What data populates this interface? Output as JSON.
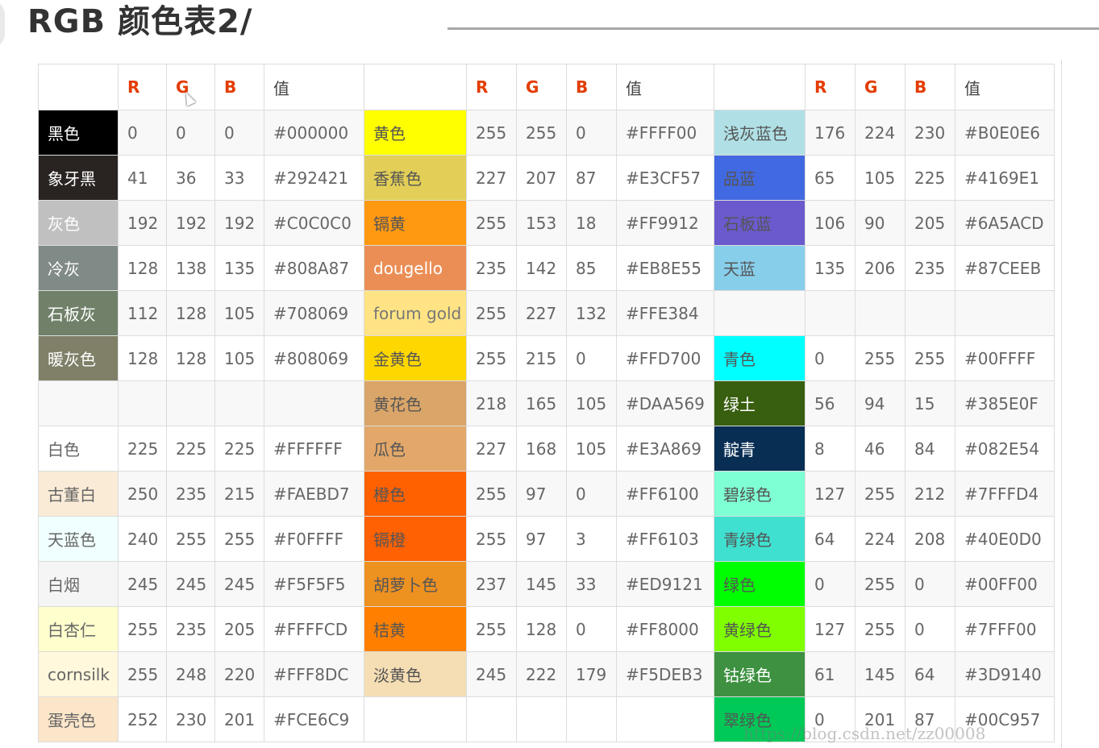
{
  "title": "RGB 颜色表2/",
  "header": [
    "",
    "R",
    "G",
    "B",
    "值",
    "",
    "R",
    "G",
    "B",
    "值",
    "",
    "R",
    "G",
    "B",
    "值"
  ],
  "rows": [
    [
      {
        "name": "黑色",
        "bg": "#000000",
        "fg": "#ffffff",
        "r": "0",
        "g": "0",
        "b": "0",
        "hex": "#000000"
      },
      {
        "name": "黄色",
        "bg": "#FFFF00",
        "fg": "#555555",
        "r": "255",
        "g": "255",
        "b": "0",
        "hex": "#FFFF00"
      },
      {
        "name": "浅灰蓝色",
        "bg": "#B0E0E6",
        "fg": "#555555",
        "r": "176",
        "g": "224",
        "b": "230",
        "hex": "#B0E0E6"
      }
    ],
    [
      {
        "name": "象牙黑",
        "bg": "#292421",
        "fg": "#ffffff",
        "r": "41",
        "g": "36",
        "b": "33",
        "hex": "#292421"
      },
      {
        "name": "香蕉色",
        "bg": "#E3CF57",
        "fg": "#555555",
        "r": "227",
        "g": "207",
        "b": "87",
        "hex": "#E3CF57"
      },
      {
        "name": "品蓝",
        "bg": "#4169E1",
        "fg": "#555555",
        "r": "65",
        "g": "105",
        "b": "225",
        "hex": "#4169E1"
      }
    ],
    [
      {
        "name": "灰色",
        "bg": "#C0C0C0",
        "fg": "#ffffff",
        "r": "192",
        "g": "192",
        "b": "192",
        "hex": "#C0C0C0"
      },
      {
        "name": "镉黄",
        "bg": "#FF9912",
        "fg": "#555555",
        "r": "255",
        "g": "153",
        "b": "18",
        "hex": "#FF9912"
      },
      {
        "name": "石板蓝",
        "bg": "#6A5ACD",
        "fg": "#555555",
        "r": "106",
        "g": "90",
        "b": "205",
        "hex": "#6A5ACD"
      }
    ],
    [
      {
        "name": "冷灰",
        "bg": "#808A87",
        "fg": "#ffffff",
        "r": "128",
        "g": "138",
        "b": "135",
        "hex": "#808A87"
      },
      {
        "name": "dougello",
        "bg": "#EB8E55",
        "fg": "#ffffff",
        "r": "235",
        "g": "142",
        "b": "85",
        "hex": "#EB8E55"
      },
      {
        "name": "天蓝",
        "bg": "#87CEEB",
        "fg": "#555555",
        "r": "135",
        "g": "206",
        "b": "235",
        "hex": "#87CEEB"
      }
    ],
    [
      {
        "name": "石板灰",
        "bg": "#708069",
        "fg": "#ffffff",
        "r": "112",
        "g": "128",
        "b": "105",
        "hex": "#708069"
      },
      {
        "name": "forum gold",
        "bg": "#FFE384",
        "fg": "#777777",
        "r": "255",
        "g": "227",
        "b": "132",
        "hex": "#FFE384"
      },
      {
        "name": "",
        "bg": "",
        "fg": "",
        "r": "",
        "g": "",
        "b": "",
        "hex": ""
      }
    ],
    [
      {
        "name": "暖灰色",
        "bg": "#808069",
        "fg": "#ffffff",
        "r": "128",
        "g": "128",
        "b": "105",
        "hex": "#808069"
      },
      {
        "name": "金黄色",
        "bg": "#FFD700",
        "fg": "#555555",
        "r": "255",
        "g": "215",
        "b": "0",
        "hex": "#FFD700"
      },
      {
        "name": "青色",
        "bg": "#00FFFF",
        "fg": "#555555",
        "r": "0",
        "g": "255",
        "b": "255",
        "hex": "#00FFFF"
      }
    ],
    [
      {
        "name": "",
        "bg": "",
        "fg": "",
        "r": "",
        "g": "",
        "b": "",
        "hex": ""
      },
      {
        "name": "黄花色",
        "bg": "#DAA569",
        "fg": "#555555",
        "r": "218",
        "g": "165",
        "b": "105",
        "hex": "#DAA569"
      },
      {
        "name": "绿土",
        "bg": "#385E0F",
        "fg": "#ffffff",
        "r": "56",
        "g": "94",
        "b": "15",
        "hex": "#385E0F"
      }
    ],
    [
      {
        "name": "白色",
        "bg": "#FFFFFF",
        "fg": "#666666",
        "r": "225",
        "g": "225",
        "b": "225",
        "hex": "#FFFFFF"
      },
      {
        "name": "瓜色",
        "bg": "#E3A869",
        "fg": "#555555",
        "r": "227",
        "g": "168",
        "b": "105",
        "hex": "#E3A869"
      },
      {
        "name": "靛青",
        "bg": "#082E54",
        "fg": "#ffffff",
        "r": "8",
        "g": "46",
        "b": "84",
        "hex": "#082E54"
      }
    ],
    [
      {
        "name": "古董白",
        "bg": "#FAEBD7",
        "fg": "#666666",
        "r": "250",
        "g": "235",
        "b": "215",
        "hex": "#FAEBD7"
      },
      {
        "name": "橙色",
        "bg": "#FF6100",
        "fg": "#555555",
        "r": "255",
        "g": "97",
        "b": "0",
        "hex": "#FF6100"
      },
      {
        "name": "碧绿色",
        "bg": "#7FFFD4",
        "fg": "#555555",
        "r": "127",
        "g": "255",
        "b": "212",
        "hex": "#7FFFD4"
      }
    ],
    [
      {
        "name": "天蓝色",
        "bg": "#F0FFFF",
        "fg": "#666666",
        "r": "240",
        "g": "255",
        "b": "255",
        "hex": "#F0FFFF"
      },
      {
        "name": "镉橙",
        "bg": "#FF6103",
        "fg": "#555555",
        "r": "255",
        "g": "97",
        "b": "3",
        "hex": "#FF6103"
      },
      {
        "name": "青绿色",
        "bg": "#40E0D0",
        "fg": "#555555",
        "r": "64",
        "g": "224",
        "b": "208",
        "hex": "#40E0D0"
      }
    ],
    [
      {
        "name": "白烟",
        "bg": "#F5F5F5",
        "fg": "#666666",
        "r": "245",
        "g": "245",
        "b": "245",
        "hex": "#F5F5F5"
      },
      {
        "name": "胡萝卜色",
        "bg": "#ED9121",
        "fg": "#555555",
        "r": "237",
        "g": "145",
        "b": "33",
        "hex": "#ED9121"
      },
      {
        "name": "绿色",
        "bg": "#00FF00",
        "fg": "#555555",
        "r": "0",
        "g": "255",
        "b": "0",
        "hex": "#00FF00"
      }
    ],
    [
      {
        "name": "白杏仁",
        "bg": "#FFFFCD",
        "fg": "#666666",
        "r": "255",
        "g": "235",
        "b": "205",
        "hex": "#FFFFCD"
      },
      {
        "name": "桔黄",
        "bg": "#FF8000",
        "fg": "#555555",
        "r": "255",
        "g": "128",
        "b": "0",
        "hex": "#FF8000"
      },
      {
        "name": "黄绿色",
        "bg": "#7FFF00",
        "fg": "#555555",
        "r": "127",
        "g": "255",
        "b": "0",
        "hex": "#7FFF00"
      }
    ],
    [
      {
        "name": "cornsilk",
        "bg": "#FFF8DC",
        "fg": "#666666",
        "r": "255",
        "g": "248",
        "b": "220",
        "hex": "#FFF8DC"
      },
      {
        "name": "淡黄色",
        "bg": "#F5DEB3",
        "fg": "#555555",
        "r": "245",
        "g": "222",
        "b": "179",
        "hex": "#F5DEB3"
      },
      {
        "name": "钴绿色",
        "bg": "#3D9140",
        "fg": "#ffffff",
        "r": "61",
        "g": "145",
        "b": "64",
        "hex": "#3D9140"
      }
    ],
    [
      {
        "name": "蛋壳色",
        "bg": "#FCE6C9",
        "fg": "#666666",
        "r": "252",
        "g": "230",
        "b": "201",
        "hex": "#FCE6C9"
      },
      {
        "name": "",
        "bg": "",
        "fg": "",
        "r": "",
        "g": "",
        "b": "",
        "hex": ""
      },
      {
        "name": "翠绿色",
        "bg": "#00C957",
        "fg": "#555555",
        "r": "0",
        "g": "201",
        "b": "87",
        "hex": "#00C957"
      }
    ]
  ],
  "watermark": "https://blog.csdn.net/zz00008",
  "colors": {
    "header_accent": "#e33c00",
    "border": "#dcdcdc",
    "zebra": "#f8f8f8"
  }
}
